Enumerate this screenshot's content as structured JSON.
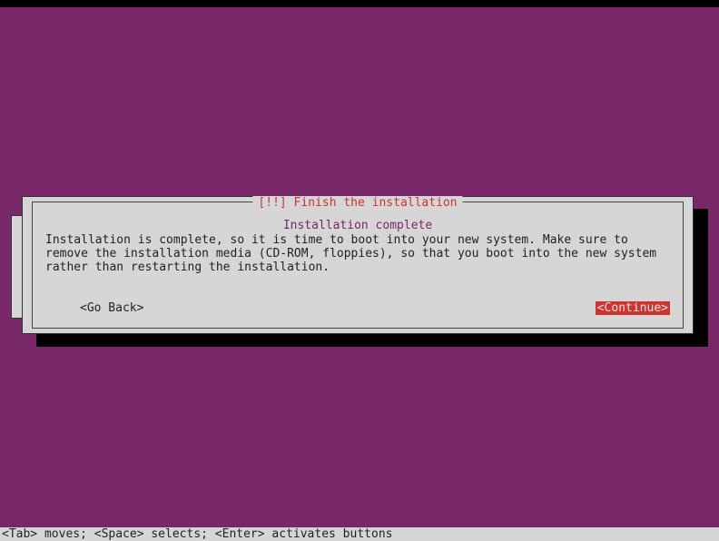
{
  "dialog": {
    "title": "[!!] Finish the installation",
    "heading": "Installation complete",
    "body": "Installation is complete, so it is time to boot into your new system. Make sure to remove the installation media (CD-ROM, floppies), so that you boot into the new system rather than restarting the installation.",
    "go_back_label": "<Go Back>",
    "continue_label": "<Continue>"
  },
  "footer": {
    "help_text": "<Tab> moves; <Space> selects; <Enter> activates buttons"
  }
}
